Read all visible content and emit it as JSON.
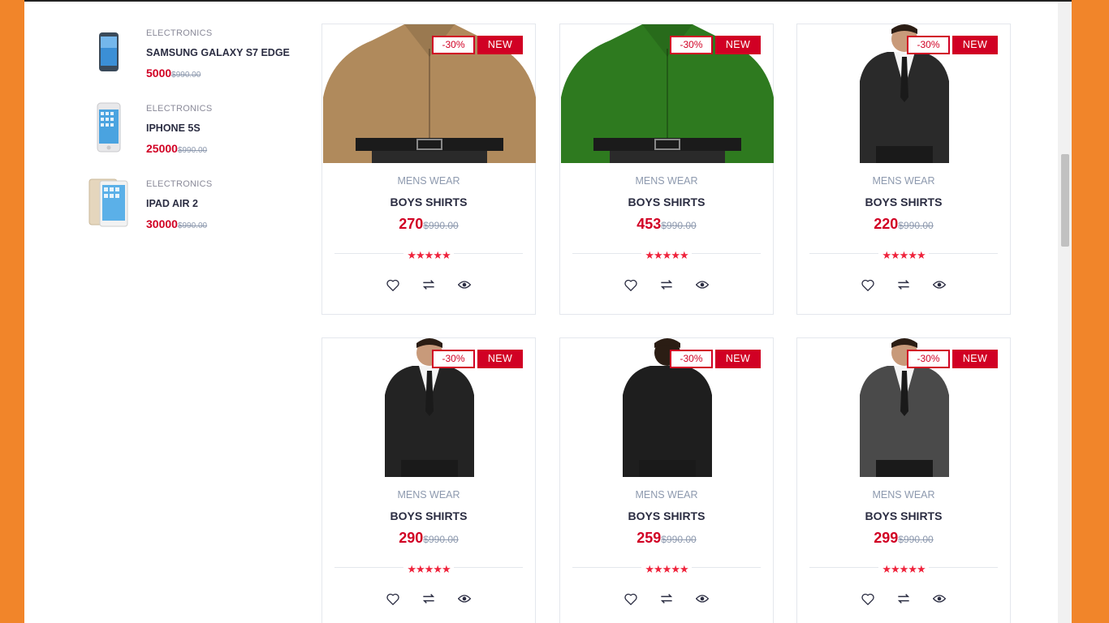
{
  "colors": {
    "accent": "#d10024",
    "star": "#ef233c",
    "text": "#2b2d42",
    "muted": "#8d99ae",
    "frame": "#f1852a"
  },
  "side_products": [
    {
      "category": "ELECTRONICS",
      "name": "SAMSUNG GALAXY S7 EDGE",
      "price": "5000",
      "old_price": "$990.00",
      "icon": "phone-icon"
    },
    {
      "category": "ELECTRONICS",
      "name": "IPHONE 5S",
      "price": "25000",
      "old_price": "$990.00",
      "icon": "phone-icon"
    },
    {
      "category": "ELECTRONICS",
      "name": "IPAD AIR 2",
      "price": "30000",
      "old_price": "$990.00",
      "icon": "tablet-icon"
    }
  ],
  "products": [
    {
      "sale": "-30%",
      "badge": "NEW",
      "category": "MENS WEAR",
      "name": "BOYS SHIRTS",
      "price": "270",
      "old_price": "$990.00",
      "rating": 5,
      "image": "shirt-icon",
      "image_color": "#b08a5c"
    },
    {
      "sale": "-30%",
      "badge": "NEW",
      "category": "MENS WEAR",
      "name": "BOYS SHIRTS",
      "price": "453",
      "old_price": "$990.00",
      "rating": 5,
      "image": "shirt-icon",
      "image_color": "#2e7a1f"
    },
    {
      "sale": "-30%",
      "badge": "NEW",
      "category": "MENS WEAR",
      "name": "BOYS SHIRTS",
      "price": "220",
      "old_price": "$990.00",
      "rating": 5,
      "image": "suit-icon",
      "image_color": "#2a2a2a"
    },
    {
      "sale": "-30%",
      "badge": "NEW",
      "category": "MENS WEAR",
      "name": "BOYS SHIRTS",
      "price": "290",
      "old_price": "$990.00",
      "rating": 5,
      "image": "suit-icon",
      "image_color": "#232323"
    },
    {
      "sale": "-30%",
      "badge": "NEW",
      "category": "MENS WEAR",
      "name": "BOYS SHIRTS",
      "price": "259",
      "old_price": "$990.00",
      "rating": 5,
      "image": "suit-back-icon",
      "image_color": "#1e1e1e"
    },
    {
      "sale": "-30%",
      "badge": "NEW",
      "category": "MENS WEAR",
      "name": "BOYS SHIRTS",
      "price": "299",
      "old_price": "$990.00",
      "rating": 5,
      "image": "suit-icon",
      "image_color": "#4a4a4a"
    }
  ],
  "actions": [
    "heart-icon",
    "exchange-icon",
    "eye-icon"
  ]
}
